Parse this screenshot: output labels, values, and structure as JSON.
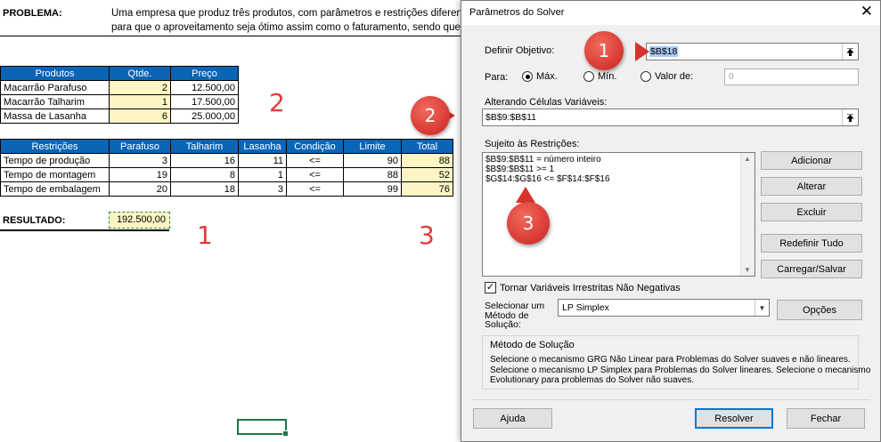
{
  "sheet": {
    "problem_label": "PROBLEMA:",
    "problem_line1": "Uma empresa que produz três produtos, com parâmetros e restrições diferen",
    "problem_line2": "para que o aproveitamento seja ótimo assim como o faturamento, sendo que",
    "products": {
      "headers": [
        "Produtos",
        "Qtde.",
        "Preço"
      ],
      "rows": [
        [
          "Macarrão Parafuso",
          "2",
          "12.500,00"
        ],
        [
          "Macarrão Talharim",
          "1",
          "17.500,00"
        ],
        [
          "Massa de Lasanha",
          "6",
          "25.000,00"
        ]
      ]
    },
    "restrictions": {
      "headers": [
        "Restrições",
        "Parafuso",
        "Talharim",
        "Lasanha",
        "Condição",
        "Limite",
        "Total"
      ],
      "rows": [
        [
          "Tempo de produção",
          "3",
          "16",
          "11",
          "<=",
          "90",
          "88"
        ],
        [
          "Tempo de montagem",
          "19",
          "8",
          "1",
          "<=",
          "88",
          "52"
        ],
        [
          "Tempo de embalagem",
          "20",
          "18",
          "3",
          "<=",
          "99",
          "76"
        ]
      ]
    },
    "result_label": "RESULTADO:",
    "result_value": "192.500,00",
    "annotations": [
      "1",
      "2",
      "3"
    ]
  },
  "dialog": {
    "title": "Parâmetros do Solver",
    "close": "✕",
    "objective_label": "Definir Objetivo:",
    "objective_value": "$B$18",
    "to_label": "Para:",
    "radio_max": "Máx.",
    "radio_min": "Mín.",
    "radio_value": "Valor de:",
    "value_of": "0",
    "changing_label": "Alterando Células Variáveis:",
    "changing_value": "$B$9:$B$11",
    "constraints_label": "Sujeito às Restrições:",
    "constraints": [
      "$B$9:$B$11 = número inteiro",
      "$B$9:$B$11 >= 1",
      "$G$14:$G$16 <= $F$14:$F$16"
    ],
    "buttons": {
      "add": "Adicionar",
      "change": "Alterar",
      "delete": "Excluir",
      "reset": "Redefinir Tudo",
      "load_save": "Carregar/Salvar",
      "options": "Opções",
      "help": "Ajuda",
      "solve": "Resolver",
      "close": "Fechar"
    },
    "checkbox_label": "Tornar Variáveis Irrestritas Não Negativas",
    "method_label": [
      "Selecionar um",
      "Método de",
      "Solução:"
    ],
    "method_value": "LP Simplex",
    "method_group_title": "Método de Solução",
    "method_description": [
      "Selecione o mecanismo GRG Não Linear para Problemas do Solver suaves e não lineares.",
      "Selecione o mecanismo LP Simplex para Problemas do Solver lineares. Selecione o mecanismo",
      "Evolutionary para problemas do Solver não suaves."
    ],
    "badges": [
      "1",
      "2",
      "3"
    ]
  },
  "colors": {
    "header_blue": "#0a65b7",
    "input_yellow": "#fdf5c3",
    "annotation_red": "#e23b38"
  }
}
